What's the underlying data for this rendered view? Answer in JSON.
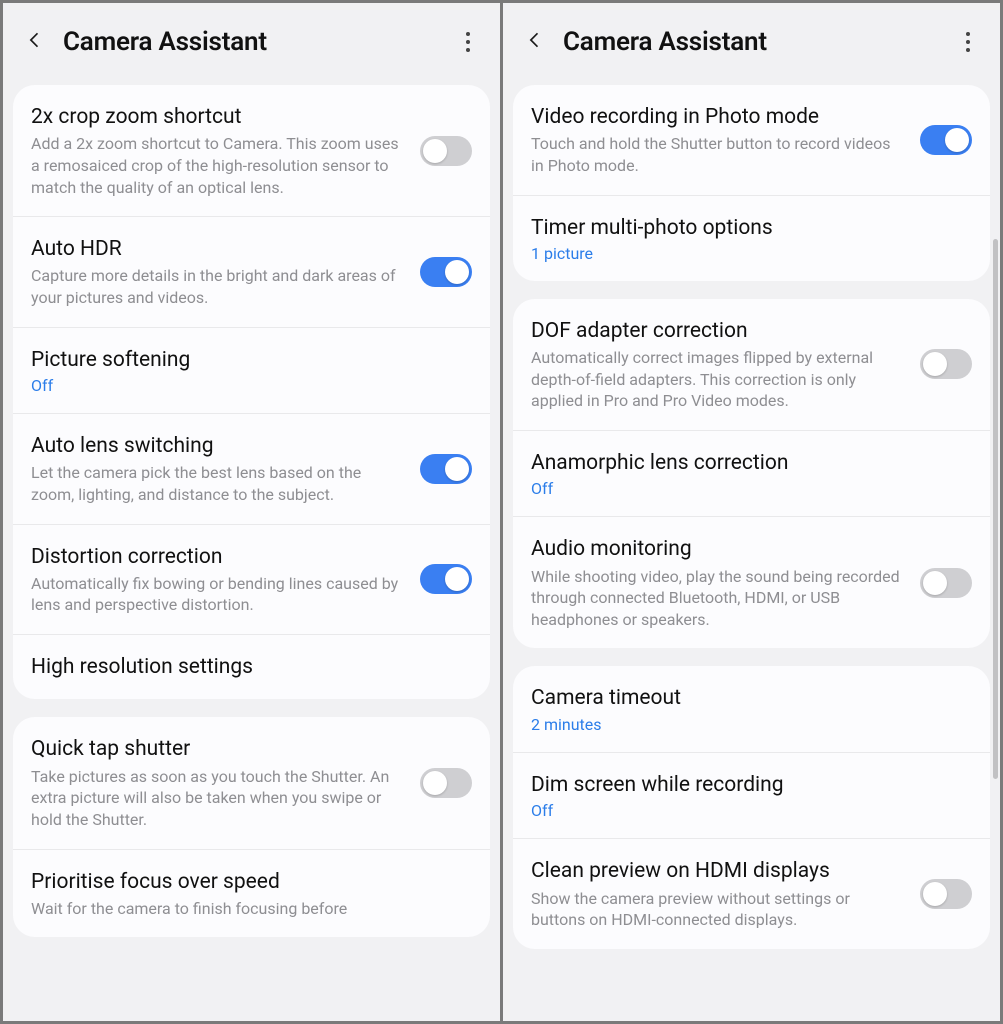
{
  "left": {
    "title": "Camera Assistant",
    "groups": [
      {
        "rows": [
          {
            "id": "crop-zoom",
            "title": "2x crop zoom shortcut",
            "desc": "Add a 2x zoom shortcut to Camera. This zoom uses a remosaiced crop of the high-resolution sensor to match the quality of an optical lens.",
            "toggle": false
          },
          {
            "id": "auto-hdr",
            "title": "Auto HDR",
            "desc": "Capture more details in the bright and dark areas of your pictures and videos.",
            "toggle": true
          },
          {
            "id": "picture-softening",
            "title": "Picture softening",
            "value": "Off"
          },
          {
            "id": "auto-lens",
            "title": "Auto lens switching",
            "desc": "Let the camera pick the best lens based on the zoom, lighting, and distance to the subject.",
            "toggle": true
          },
          {
            "id": "distortion",
            "title": "Distortion correction",
            "desc": "Automatically fix bowing or bending lines caused by lens and perspective distortion.",
            "toggle": true
          },
          {
            "id": "high-res",
            "title": "High resolution settings"
          }
        ]
      },
      {
        "rows": [
          {
            "id": "quick-tap",
            "title": "Quick tap shutter",
            "desc": "Take pictures as soon as you touch the Shutter. An extra picture will also be taken when you swipe or hold the Shutter.",
            "toggle": false
          },
          {
            "id": "prioritise-focus",
            "title": "Prioritise focus over speed",
            "desc": "Wait for the camera to finish focusing before",
            "toggle": false
          }
        ]
      }
    ]
  },
  "right": {
    "title": "Camera Assistant",
    "groups": [
      {
        "rows": [
          {
            "id": "video-photo",
            "title": "Video recording in Photo mode",
            "desc": "Touch and hold the Shutter button to record videos in Photo mode.",
            "toggle": true
          },
          {
            "id": "timer-multi",
            "title": "Timer multi-photo options",
            "value": "1 picture"
          }
        ]
      },
      {
        "rows": [
          {
            "id": "dof",
            "title": "DOF adapter correction",
            "desc": "Automatically correct images flipped by external depth-of-field adapters. This correction is only applied in Pro and Pro Video modes.",
            "toggle": false
          },
          {
            "id": "anamorphic",
            "title": "Anamorphic lens correction",
            "value": "Off"
          },
          {
            "id": "audio-mon",
            "title": "Audio monitoring",
            "desc": "While shooting video, play the sound being recorded through connected Bluetooth, HDMI, or USB headphones or speakers.",
            "toggle": false
          }
        ]
      },
      {
        "rows": [
          {
            "id": "camera-timeout",
            "title": "Camera timeout",
            "value": "2 minutes"
          },
          {
            "id": "dim-screen",
            "title": "Dim screen while recording",
            "value": "Off"
          },
          {
            "id": "clean-preview",
            "title": "Clean preview on HDMI displays",
            "desc": "Show the camera preview without settings or buttons on HDMI-connected displays.",
            "toggle": false
          }
        ]
      }
    ]
  }
}
